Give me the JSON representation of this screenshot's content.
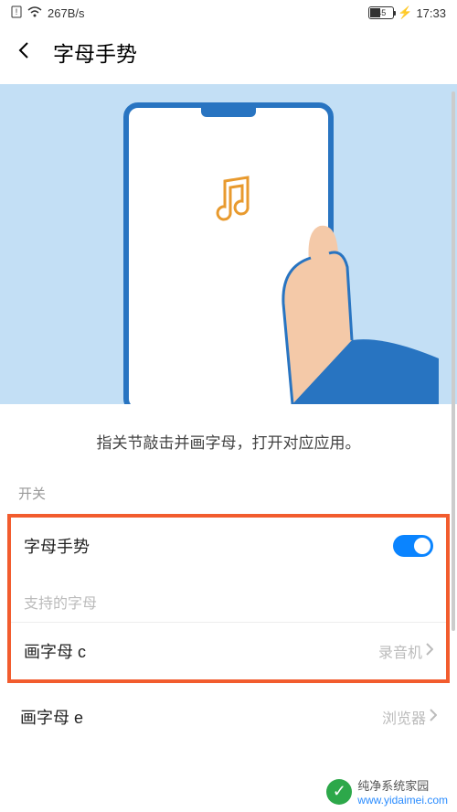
{
  "status": {
    "speed": "267B/s",
    "battery": "45",
    "time": "17:33"
  },
  "header": {
    "title": "字母手势"
  },
  "hero": {
    "desc": "指关节敲击并画字母，打开对应应用。"
  },
  "section_switch": "开关",
  "toggle_row": {
    "label": "字母手势"
  },
  "supported_label": "支持的字母",
  "rows": [
    {
      "label": "画字母 c",
      "value": "录音机"
    },
    {
      "label": "画字母 e",
      "value": "浏览器"
    }
  ],
  "watermark": {
    "label": "纯净系统家园",
    "host": "www.yidaimei.com"
  }
}
